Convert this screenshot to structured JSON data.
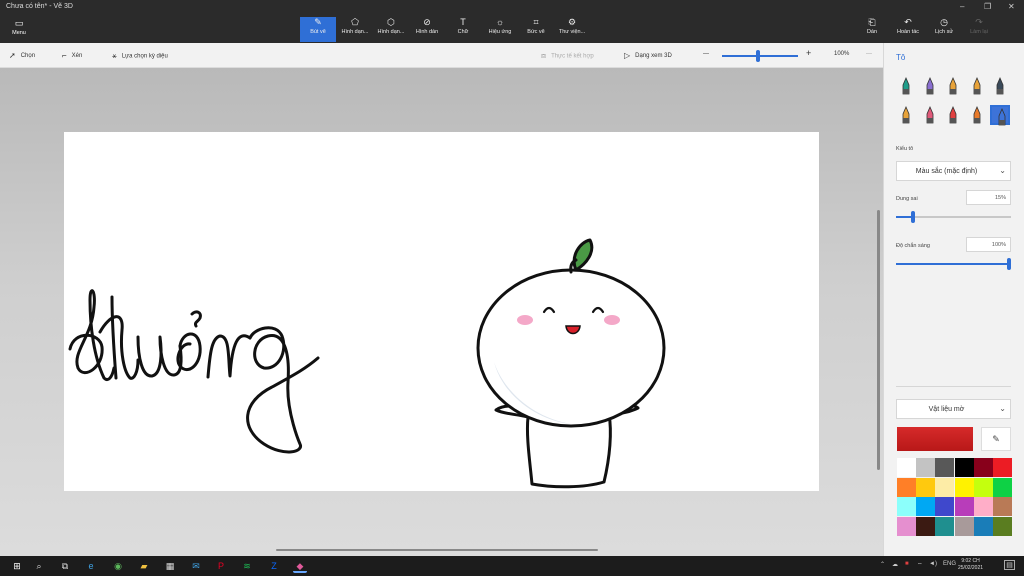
{
  "window": {
    "title": "Chưa có tên* - Vẽ 3D",
    "controls": [
      "–",
      "❐",
      "✕"
    ]
  },
  "ribbon": {
    "menu_label": "Menu",
    "tools": [
      {
        "label": "Bút vẽ",
        "icon": "brush-icon",
        "glyph": "✎"
      },
      {
        "label": "Hình dạn...",
        "icon": "2d-shapes-icon",
        "glyph": "⬠"
      },
      {
        "label": "Hình dạn...",
        "icon": "3d-shapes-icon",
        "glyph": "⬡"
      },
      {
        "label": "Hình dán",
        "icon": "stickers-icon",
        "glyph": "⊘"
      },
      {
        "label": "Chữ",
        "icon": "text-icon",
        "glyph": "T"
      },
      {
        "label": "Hiệu ứng",
        "icon": "effects-icon",
        "glyph": "☼"
      },
      {
        "label": "Bức vẽ",
        "icon": "canvas-icon",
        "glyph": "⌗"
      },
      {
        "label": "Thư viện...",
        "icon": "library-icon",
        "glyph": "⚙"
      }
    ],
    "right_tools": [
      {
        "label": "Dán",
        "icon": "paste-icon",
        "glyph": "⎗"
      },
      {
        "label": "Hoàn tác",
        "icon": "undo-icon",
        "glyph": "↶"
      },
      {
        "label": "Lịch sử",
        "icon": "history-icon",
        "glyph": "◷"
      },
      {
        "label": "Làm lại",
        "icon": "redo-icon",
        "glyph": "↷"
      }
    ]
  },
  "subbar": {
    "select": "Chọn",
    "crop": "Xén",
    "magic_select": "Lựa chọn kỳ diệu",
    "mixed_reality": "Thực tế kết hợp",
    "view_3d": "Dạng xem 3D",
    "zoom_minus": "—",
    "zoom_plus": "+",
    "zoom_level": "100%",
    "more": "···"
  },
  "panel": {
    "heading": "Tô",
    "brush_type_label": "Kiểu tô",
    "color_mode": "Màu sắc (mặc định)",
    "tolerance_label": "Dung sai",
    "tolerance_value": "15%",
    "tolerance_fraction": 0.15,
    "opacity_label": "Độ chắn sáng",
    "opacity_value": "100%",
    "opacity_fraction": 1.0,
    "material": "Vật liệu mờ",
    "brushes": [
      {
        "name": "marker-icon",
        "color": "#1f9d8a"
      },
      {
        "name": "calligraphy-pen-icon",
        "color": "#8a6fd0"
      },
      {
        "name": "oil-brush-icon",
        "color": "#e8a33a"
      },
      {
        "name": "watercolor-icon",
        "color": "#e8a33a"
      },
      {
        "name": "pixel-pen-icon",
        "color": "#3a4a5a"
      },
      {
        "name": "pencil-icon",
        "color": "#e8a33a"
      },
      {
        "name": "eraser-icon",
        "color": "#e05a7a"
      },
      {
        "name": "crayon-icon",
        "color": "#e04040"
      },
      {
        "name": "spray-can-icon",
        "color": "#e87a2a"
      },
      {
        "name": "fill-bucket-icon",
        "color": "#3d73d8"
      }
    ],
    "selected_color": "#d62a2a",
    "palette": [
      "#ffffff",
      "#c3c3c3",
      "#585858",
      "#000000",
      "#88001b",
      "#ec1c24",
      "#ff7f27",
      "#ffc90e",
      "#fdeca6",
      "#fff200",
      "#c4ff0e",
      "#0ed145",
      "#8cfffb",
      "#00a8f3",
      "#3f48cc",
      "#b83dba",
      "#ffaec8",
      "#b97a56",
      "#e58fcf",
      "#3b1a12",
      "#1f8f8f",
      "#a89a9a",
      "#1a7db8",
      "#5a7d20"
    ]
  },
  "canvas": {
    "handwriting_icon": "handwritten-word-drawing",
    "character_icon": "cute-character-drawing"
  },
  "taskbar": {
    "apps": [
      {
        "icon": "start-icon",
        "glyph": "⊞",
        "color": "#ffffff"
      },
      {
        "icon": "search-icon",
        "glyph": "⌕",
        "color": "#dddddd"
      },
      {
        "icon": "task-view-icon",
        "glyph": "⧉",
        "color": "#dddddd"
      },
      {
        "icon": "edge-icon",
        "glyph": "e",
        "color": "#3fa0e0"
      },
      {
        "icon": "chrome-icon",
        "glyph": "◉",
        "color": "#5cb85c"
      },
      {
        "icon": "explorer-icon",
        "glyph": "▰",
        "color": "#f0c040"
      },
      {
        "icon": "store-icon",
        "glyph": "▦",
        "color": "#dddddd"
      },
      {
        "icon": "mail-icon",
        "glyph": "✉",
        "color": "#3fa0e0"
      },
      {
        "icon": "pinterest-icon",
        "glyph": "P",
        "color": "#e60023"
      },
      {
        "icon": "spotify-icon",
        "glyph": "≋",
        "color": "#1db954"
      },
      {
        "icon": "zalo-icon",
        "glyph": "Z",
        "color": "#0a68fe"
      },
      {
        "icon": "paint3d-icon",
        "glyph": "◆",
        "color": "#e05a9a"
      }
    ],
    "language": "ENG",
    "time": "9:02 CH",
    "date": "25/02/2021"
  }
}
